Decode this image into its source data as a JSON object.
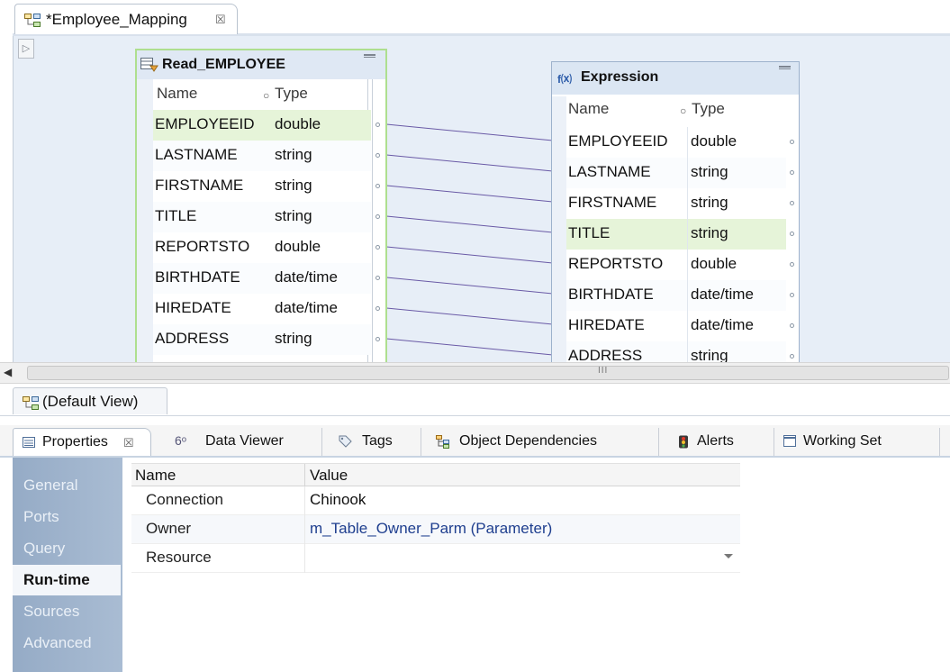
{
  "editor": {
    "tab_title": "*Employee_Mapping",
    "tab_close": "☒",
    "view_label": "(Default View)",
    "scroll_grip": "III"
  },
  "read_employee": {
    "title": "Read_EMPLOYEE",
    "col_name": "Name",
    "col_type": "Type",
    "ports": [
      {
        "name": "EMPLOYEEID",
        "type": "double"
      },
      {
        "name": "LASTNAME",
        "type": "string"
      },
      {
        "name": "FIRSTNAME",
        "type": "string"
      },
      {
        "name": "TITLE",
        "type": "string"
      },
      {
        "name": "REPORTSTO",
        "type": "double"
      },
      {
        "name": "BIRTHDATE",
        "type": "date/time"
      },
      {
        "name": "HIREDATE",
        "type": "date/time"
      },
      {
        "name": "ADDRESS",
        "type": "string"
      }
    ],
    "highlight_color": "#e6f4d9"
  },
  "expression": {
    "icon_text": "f⒳",
    "title": "Expression",
    "col_name": "Name",
    "col_type": "Type",
    "ports": [
      {
        "name": "EMPLOYEEID",
        "type": "double"
      },
      {
        "name": "LASTNAME",
        "type": "string"
      },
      {
        "name": "FIRSTNAME",
        "type": "string"
      },
      {
        "name": "TITLE",
        "type": "string"
      },
      {
        "name": "REPORTSTO",
        "type": "double"
      },
      {
        "name": "BIRTHDATE",
        "type": "date/time"
      },
      {
        "name": "HIREDATE",
        "type": "date/time"
      },
      {
        "name": "ADDRESS",
        "type": "string"
      }
    ],
    "highlight_color": "#e6f4d9"
  },
  "props_tabs": [
    {
      "label": "Properties",
      "close": "☒",
      "icon": "properties-icon"
    },
    {
      "label": "Data Viewer",
      "icon": "data-viewer-icon"
    },
    {
      "label": "Tags",
      "icon": "tag-icon"
    },
    {
      "label": "Object Dependencies",
      "icon": "dependencies-icon"
    },
    {
      "label": "Alerts",
      "icon": "alert-icon"
    },
    {
      "label": "Working Set",
      "icon": "window-icon"
    }
  ],
  "side_nav": {
    "items": [
      "General",
      "Ports",
      "Query",
      "Run-time",
      "Sources",
      "Advanced"
    ],
    "active": "Run-time"
  },
  "prop_table": {
    "col_name": "Name",
    "col_value": "Value",
    "rows": [
      {
        "name": "Connection",
        "value": "Chinook"
      },
      {
        "name": "Owner",
        "value": "m_Table_Owner_Parm (Parameter)"
      },
      {
        "name": "Resource",
        "value": ""
      }
    ]
  },
  "colors": {
    "canvas": "#e7eef7",
    "link_line": "#6a5aa6",
    "nav_gradient": "#95abc6"
  }
}
